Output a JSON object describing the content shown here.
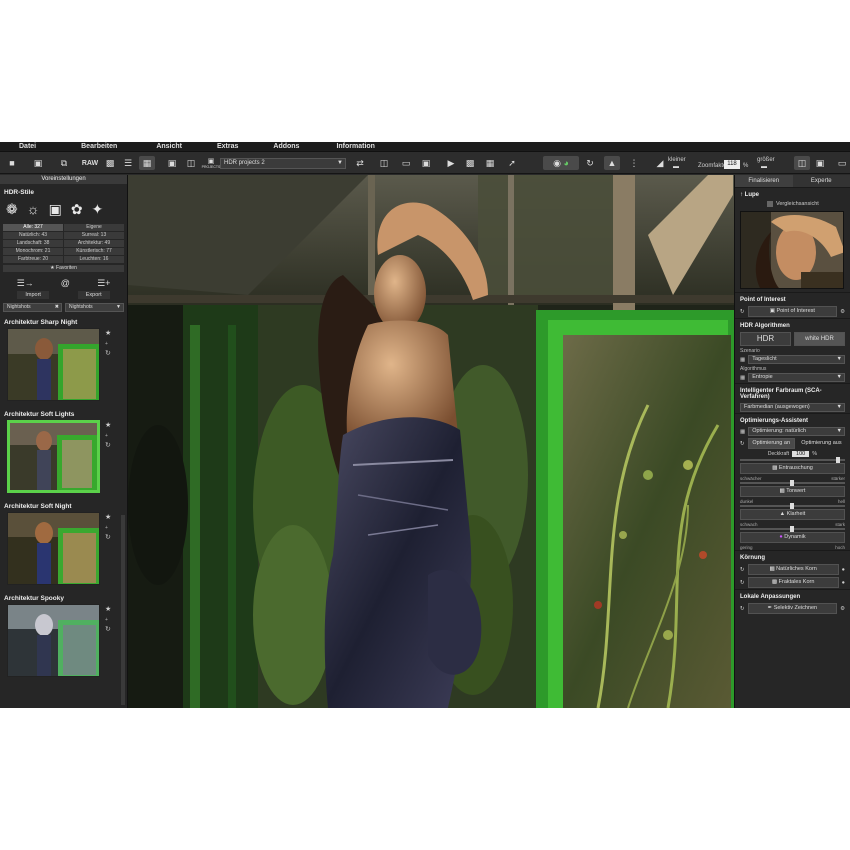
{
  "menu": [
    "Datei",
    "Bearbeiten",
    "Ansicht",
    "Extras",
    "Addons",
    "Information"
  ],
  "toolbar": {
    "raw_label": "RAW",
    "projects_label": "PROJECTS",
    "project_select": "HDR projects 2",
    "small_label": "kleiner",
    "zoom_label": "Zoomfaktor",
    "zoom_value": "118",
    "zoom_unit": "%",
    "larger_label": "größer"
  },
  "left": {
    "header": "Voreinstellungen",
    "section": "HDR-Stile",
    "categories": [
      "Alle: 327",
      "Eigene",
      "Natürlich: 43",
      "Surreal: 13",
      "Landschaft: 38",
      "Architektur: 49",
      "Monochrom: 21",
      "Künstlerisch: 77",
      "Farbtreue: 20",
      "Leuchten: 16"
    ],
    "favorites": "Favoriten",
    "import": "Import",
    "export": "Export",
    "filter1": "Nightshots",
    "filter2": "Nightshots",
    "presets": [
      "Architektur Sharp Night",
      "Architektur Soft Lights",
      "Architektur Soft Night",
      "Architektur Spooky"
    ]
  },
  "right": {
    "tabs": [
      "Finalisieren",
      "Experte"
    ],
    "loupe": "Lupe",
    "compare": "Vergleichsansicht",
    "poi_title": "Point of Interest",
    "poi_button": "Point of Interest",
    "algo_title": "HDR Algorithmen",
    "algo_hdr": "HDR",
    "algo_white": "white HDR",
    "scenario_label": "Szenario",
    "scenario_value": "Tageslicht",
    "algorithm_label": "Algorithmus",
    "algorithm_value": "Entropie",
    "color_title": "Intelligenter Farbraum (SCA-Verfahren)",
    "color_value": "Farbmedian (ausgewogen)",
    "opt_title": "Optimierungs-Assistent",
    "opt_value": "Optimierung: natürlich",
    "opt_on": "Optimierung an",
    "opt_off": "Optimierung aus",
    "strength_label": "Deckkraft",
    "strength_value": "100",
    "strength_unit": "%",
    "tone_button": "Entrauschung",
    "tone_low": "schwächer",
    "tone_high": "stärker",
    "tonwert": "Tonwert",
    "t_low": "dunkel",
    "t_high": "hell",
    "klarheit": "Klarheit",
    "k_low": "schwach",
    "k_high": "stark",
    "dynamik": "Dynamik",
    "d_low": "gering",
    "d_high": "hoch",
    "grain_title": "Körnung",
    "grain1": "Natürliches Korn",
    "grain2": "Fraktales Korn",
    "local_title": "Lokale Anpassungen",
    "local_button": "Selektiv Zeichnen"
  }
}
